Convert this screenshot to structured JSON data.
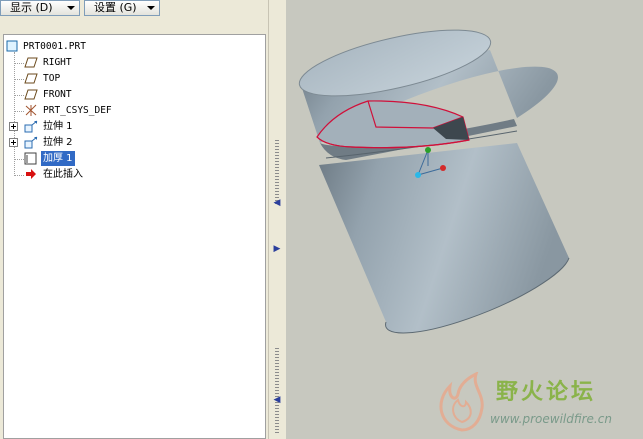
{
  "toolbar": {
    "show_label": "显示 (D)",
    "settings_label": "设置 (G)"
  },
  "tree": {
    "root": "PRT0001.PRT",
    "items": [
      {
        "label": "RIGHT",
        "icon": "datum-plane-icon"
      },
      {
        "label": "TOP",
        "icon": "datum-plane-icon"
      },
      {
        "label": "FRONT",
        "icon": "datum-plane-icon"
      },
      {
        "label": "PRT_CSYS_DEF",
        "icon": "coordinate-system-icon"
      },
      {
        "label": "拉伸 1",
        "icon": "extrude-icon"
      },
      {
        "label": "拉伸 2",
        "icon": "extrude-icon"
      },
      {
        "label": "加厚 1",
        "icon": "thicken-icon"
      },
      {
        "label": "在此插入",
        "icon": "insert-here-arrow-icon"
      }
    ]
  },
  "watermark": {
    "title": "野火论坛",
    "url": "www.proewildfire.cn"
  },
  "colors": {
    "selection": "#316ac5",
    "viewport_bg": "#c7c8bf",
    "cut_outline": "#d0103a",
    "insert_arrow": "#d81010"
  }
}
